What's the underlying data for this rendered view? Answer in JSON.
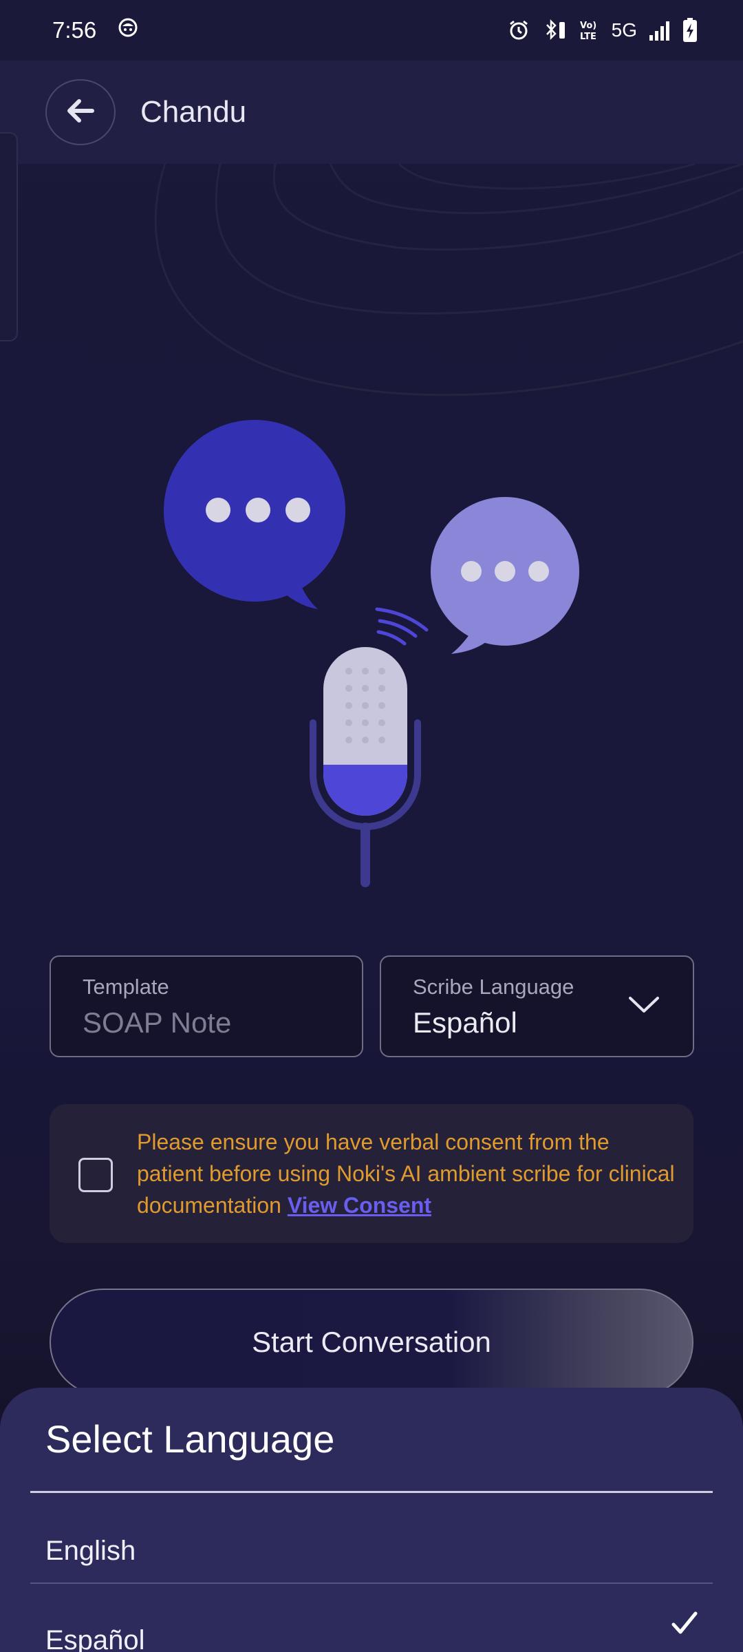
{
  "status_bar": {
    "time": "7:56",
    "network": "5G",
    "icons": [
      "notification-app-icon",
      "alarm-icon",
      "bluetooth-icon",
      "volte-icon",
      "signal-icon",
      "battery-charging-icon"
    ]
  },
  "header": {
    "title": "Chandu",
    "back_icon": "arrow-left-icon"
  },
  "illustration": {
    "icons": [
      "chat-bubble-large-icon",
      "chat-bubble-small-icon",
      "microphone-icon"
    ]
  },
  "form": {
    "template": {
      "label": "Template",
      "value": "SOAP Note"
    },
    "language": {
      "label": "Scribe Language",
      "value": "Español",
      "icon": "chevron-down-icon"
    }
  },
  "consent": {
    "text": "Please ensure you have verbal consent from the patient before using Noki's AI ambient scribe for clinical documentation ",
    "link": "View Consent",
    "checked": false
  },
  "start_button": {
    "label": "Start Conversation"
  },
  "language_sheet": {
    "title": "Select Language",
    "options": [
      {
        "label": "English",
        "selected": false
      },
      {
        "label": "Español",
        "selected": true
      }
    ]
  },
  "colors": {
    "background": "#1a1838",
    "app_bar": "#211f44",
    "accent_blue": "#3331b2",
    "accent_light": "#8a86d8",
    "consent_text": "#e09a2e",
    "link": "#6a5ef0",
    "sheet": "#2d2a5c"
  }
}
